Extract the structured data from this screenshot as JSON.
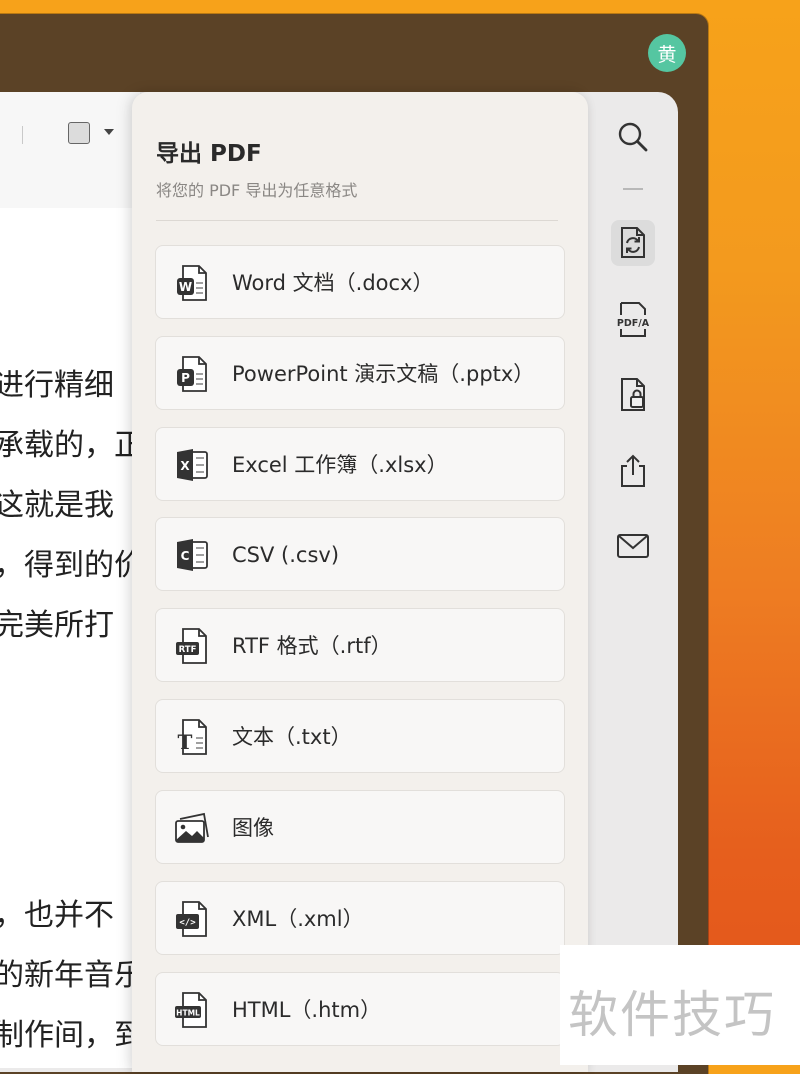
{
  "user": {
    "avatar_text": "黄",
    "avatar_color": "#55c6a1"
  },
  "document": {
    "lines": [
      {
        "text": "进行精细"
      },
      {
        "text": "承载的，正"
      },
      {
        "text": "这就是我"
      },
      {
        "text": "，得到的价"
      },
      {
        "text": "完美所打"
      },
      {
        "text": "，也并不"
      },
      {
        "text": "的新年音乐"
      },
      {
        "text": "制作间，到"
      }
    ]
  },
  "export_panel": {
    "title": "导出 PDF",
    "subtitle": "将您的 PDF 导出为任意格式",
    "options": [
      {
        "label": "Word 文档（.docx）",
        "icon": "word-file-icon"
      },
      {
        "label": "PowerPoint 演示文稿（.pptx）",
        "icon": "powerpoint-file-icon"
      },
      {
        "label": "Excel 工作簿（.xlsx）",
        "icon": "excel-file-icon"
      },
      {
        "label": "CSV (.csv)",
        "icon": "csv-file-icon"
      },
      {
        "label": "RTF 格式（.rtf）",
        "icon": "rtf-file-icon"
      },
      {
        "label": "文本（.txt）",
        "icon": "text-file-icon"
      },
      {
        "label": "图像",
        "icon": "image-icon"
      },
      {
        "label": "XML（.xml）",
        "icon": "xml-file-icon"
      },
      {
        "label": "HTML（.htm）",
        "icon": "html-file-icon"
      }
    ]
  },
  "rail": {
    "items": [
      "search-icon",
      "convert-icon",
      "pdfa-icon",
      "lock-file-icon",
      "share-icon",
      "mail-icon"
    ],
    "pdfa_label": "PDF/A"
  },
  "icon_badges": {
    "word": "W",
    "powerpoint": "P",
    "excel": "X",
    "csv": "C",
    "rtf": "RTF",
    "text": "T",
    "xml": "</>",
    "html": "HTML"
  },
  "watermark": "软件技巧"
}
